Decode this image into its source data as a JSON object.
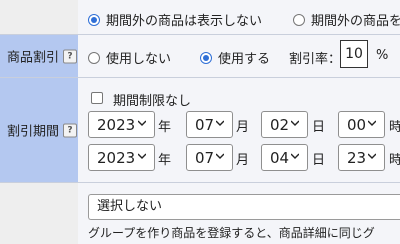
{
  "display_options": {
    "hide_out_of_period": "期間外の商品は表示しない",
    "show_out_of_period": "期間外の商品を"
  },
  "discount": {
    "label": "商品割引",
    "help": "?",
    "option_none": "使用しない",
    "option_use": "使用する",
    "rate_label": "割引率：",
    "rate_value": "10",
    "rate_unit": "%"
  },
  "period": {
    "label": "割引期間",
    "help": "?",
    "unlimited_label": "期間制限なし",
    "unit_year": "年",
    "unit_month": "月",
    "unit_day": "日",
    "unit_hour": "時",
    "start": {
      "year": "2023",
      "month": "07",
      "day": "02",
      "hour": "00"
    },
    "end": {
      "year": "2023",
      "month": "07",
      "day": "04",
      "hour": "23"
    }
  },
  "group": {
    "selected": "選択しない",
    "note": "グループを作り商品を登録すると、商品詳細に同じグ"
  }
}
